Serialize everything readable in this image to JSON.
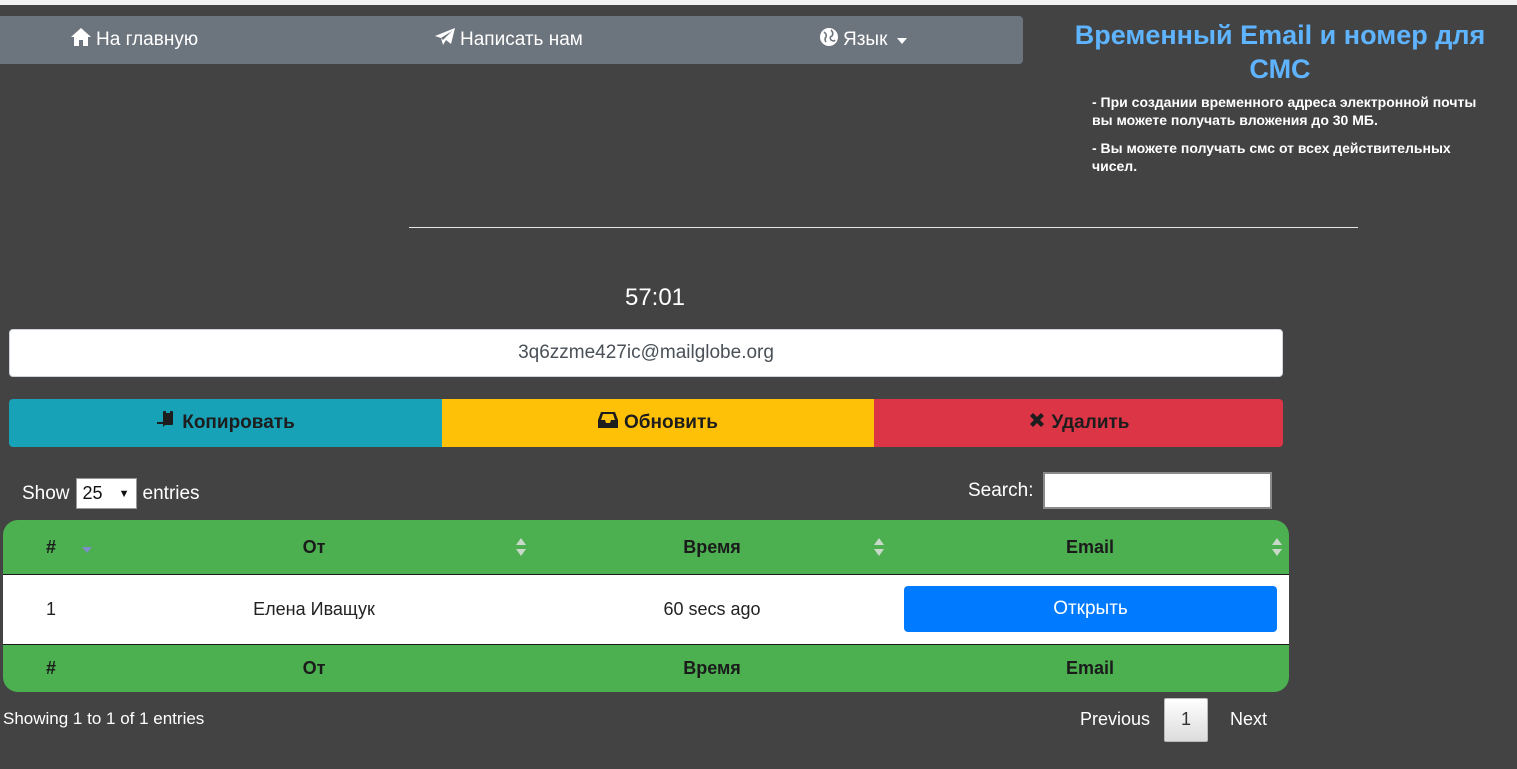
{
  "nav": {
    "home_label": "На главную",
    "contact_label": "Написать нам",
    "language_label": "Язык"
  },
  "sidebar": {
    "title": "Временный Email и номер для СМС",
    "notes": [
      "- При создании временного адреса электронной почты вы можете получать вложения до 30 МБ.",
      "- Вы можете получать смс от всех действительных чисел."
    ]
  },
  "timer": "57:01",
  "email": "3q6zzme427ic@mailglobe.org",
  "actions": {
    "copy_label": "Копировать",
    "refresh_label": "Обновить",
    "delete_label": "Удалить"
  },
  "table_controls": {
    "show_label": "Show",
    "entries_label": "entries",
    "page_size": "25",
    "search_label": "Search:"
  },
  "table": {
    "columns": [
      "#",
      "От",
      "Время",
      "Email"
    ],
    "rows": [
      {
        "num": "1",
        "from": "Елена Иващук",
        "time": "60 secs ago",
        "action": "Открыть"
      }
    ]
  },
  "footer": {
    "info": "Showing 1 to 1 of 1 entries",
    "previous": "Previous",
    "page": "1",
    "next": "Next"
  },
  "colors": {
    "background": "#434343",
    "navbar": "#6c747d",
    "title_blue": "#5fb4ff",
    "copy": "#17a2b8",
    "refresh": "#ffc107",
    "delete": "#dc3545",
    "table_header": "#4caf50",
    "open_button": "#007bff"
  },
  "icons": {
    "home": "home-icon",
    "contact": "paper-plane-icon",
    "language": "globe-icon",
    "copy": "copy-icon",
    "refresh": "inbox-icon",
    "delete": "close-icon"
  }
}
